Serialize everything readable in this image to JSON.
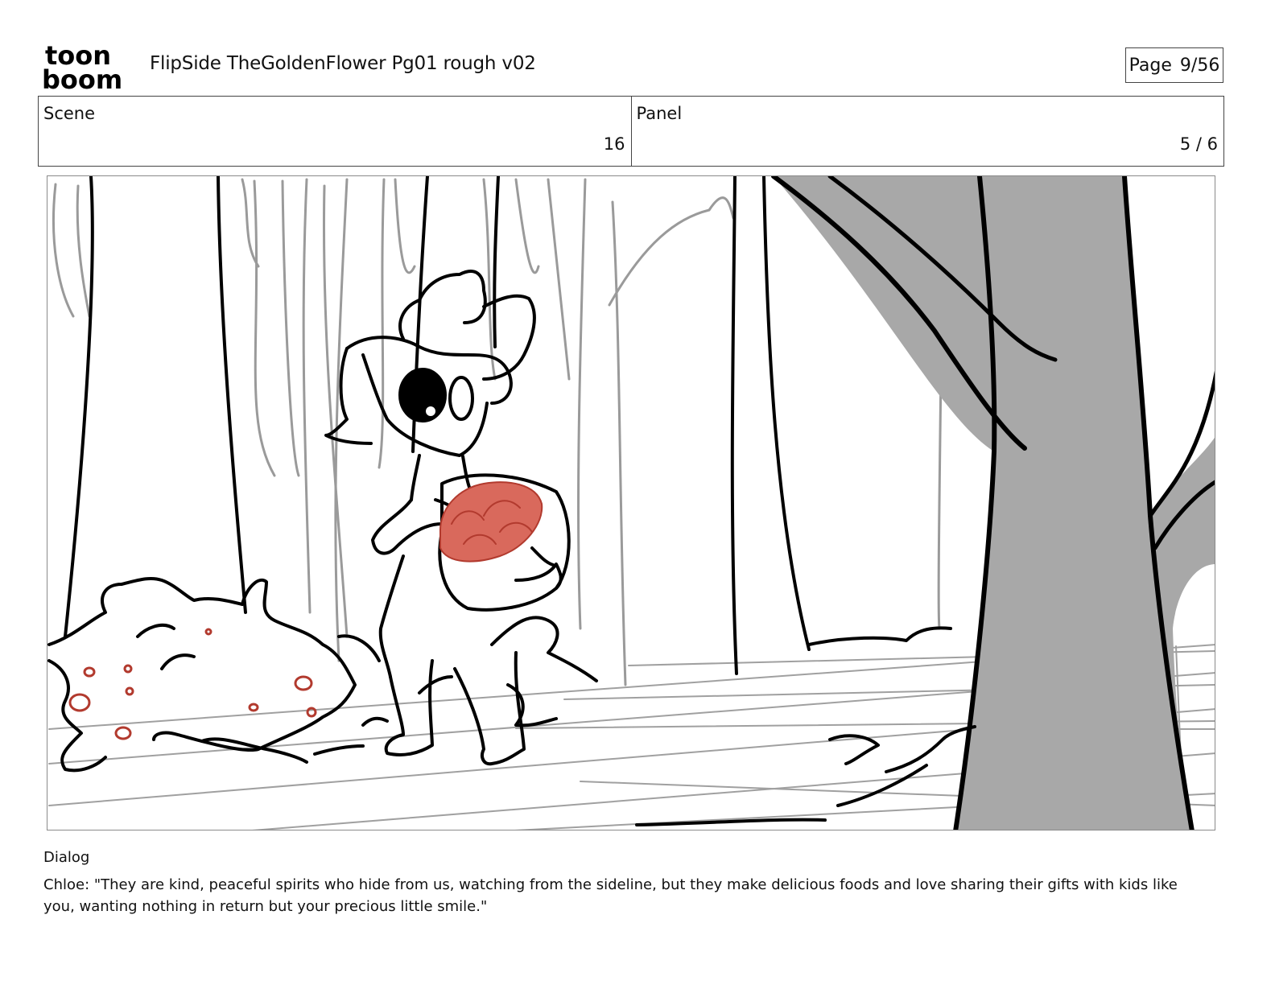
{
  "header": {
    "logo_line1": "toon",
    "logo_line2": "boom",
    "document_title": "FlipSide TheGoldenFlower Pg01 rough v02",
    "page_label": "Page",
    "page_value": "9/56"
  },
  "info": {
    "scene_label": "Scene",
    "scene_value": "16",
    "panel_label": "Panel",
    "panel_value": "5 / 6"
  },
  "dialog": {
    "label": "Dialog",
    "text": "Chloe: \"They are kind, peaceful spirits who hide from us, watching from the sideline, but they make delicious foods and love sharing their gifts with kids like you, wanting nothing in return but your precious little smile.\""
  },
  "colors": {
    "ink": "#000000",
    "rough": "#9a9a9a",
    "tree_fill": "#a8a8a8",
    "fruit_red": "#d9695c",
    "berry_red": "#b23a2e"
  }
}
